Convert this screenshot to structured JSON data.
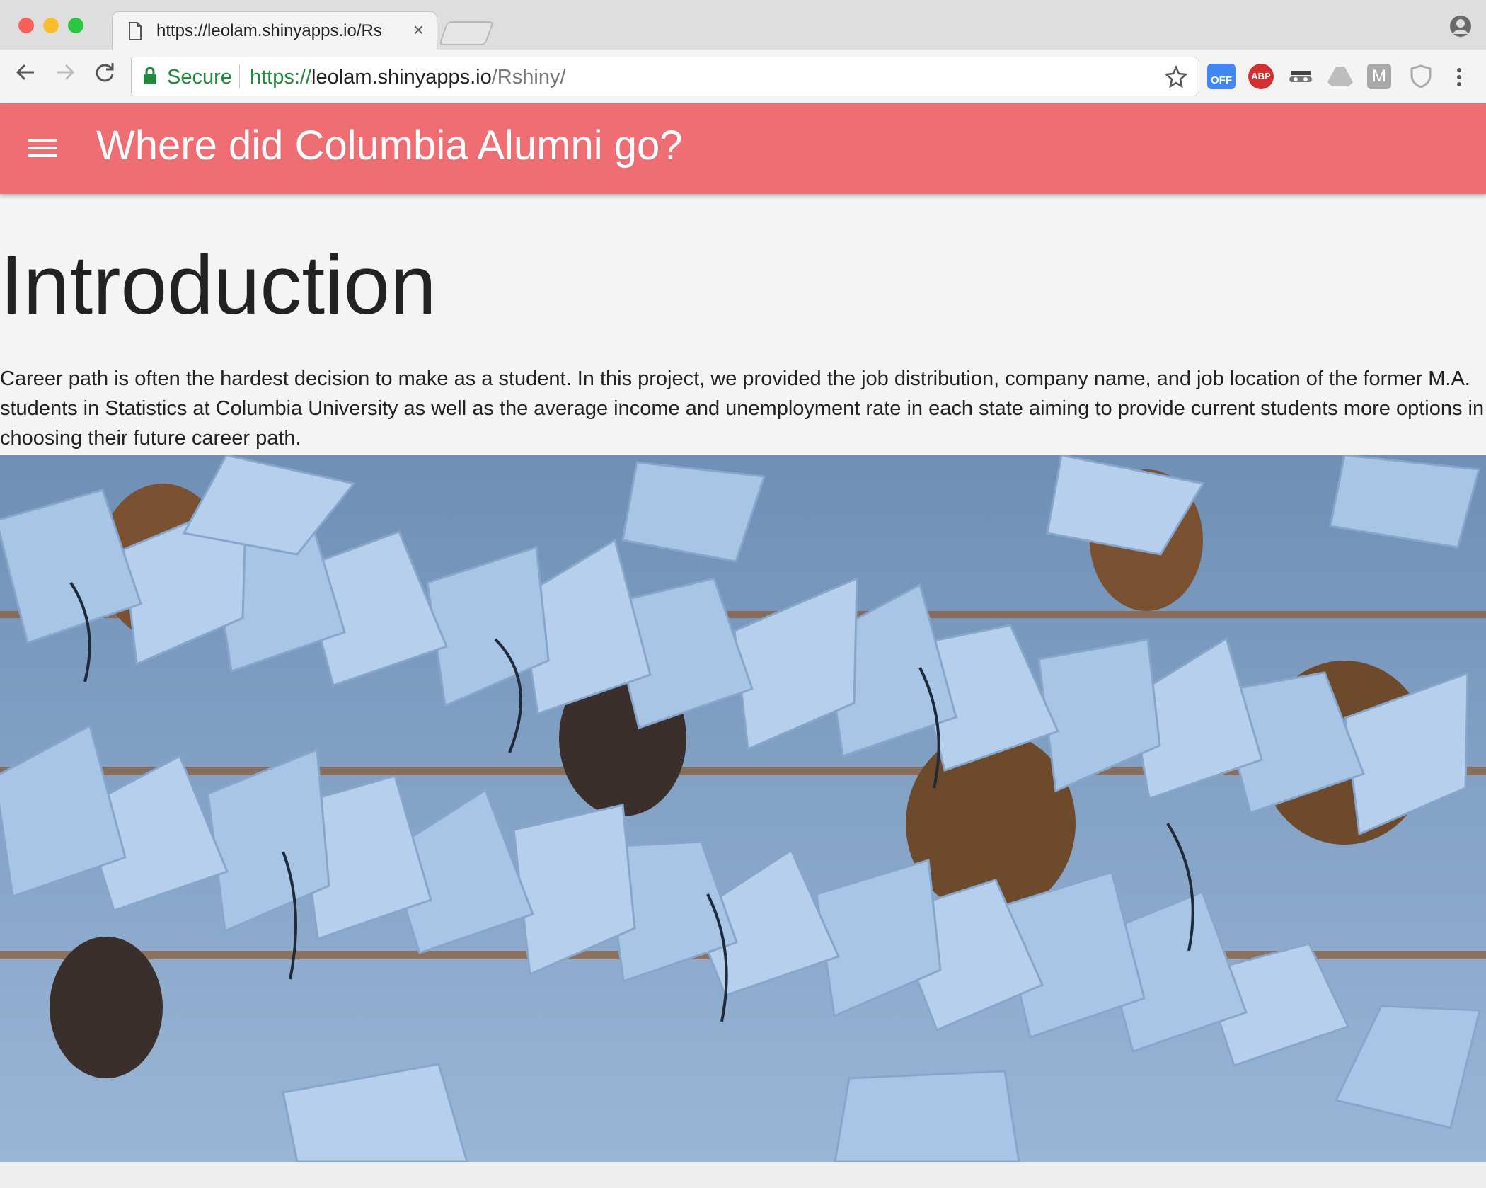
{
  "browser": {
    "tab_title": "https://leolam.shinyapps.io/Rshiny/",
    "tab_close": "×",
    "secure_label": "Secure",
    "url_scheme": "https://",
    "url_host": "leolam.shinyapps.io",
    "url_path": "/Rshiny/",
    "extensions": [
      {
        "name": "off-extension-icon",
        "label": "OFF",
        "color": "#4285f4"
      },
      {
        "name": "adblock-plus-icon",
        "label": "ABP",
        "color": "#d32f2f"
      },
      {
        "name": "incognito-mask-icon",
        "label": "",
        "color": "#555555"
      },
      {
        "name": "drive-icon",
        "label": "",
        "color": "#9e9e9e"
      },
      {
        "name": "m-extension-icon",
        "label": "M",
        "color": "#9e9e9e"
      },
      {
        "name": "shield-extension-icon",
        "label": "",
        "color": "#9e9e9e"
      }
    ]
  },
  "app": {
    "title": "Where did Columbia Alumni go?",
    "accent_color": "#ee6e73"
  },
  "main": {
    "heading": "Introduction",
    "paragraph": "Career path is often the hardest decision to make as a student. In this project, we provided the job distribution, company name, and job location of the former M.A. students in Statistics at Columbia University as well as the average income and unemployment rate in each state aiming to provide current students more options in choosing their future career path."
  }
}
